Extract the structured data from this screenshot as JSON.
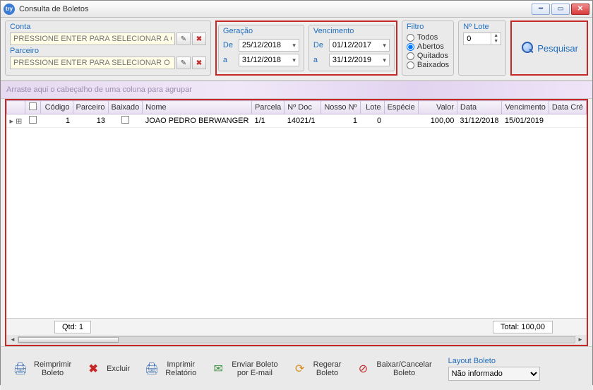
{
  "window": {
    "title": "Consulta de Boletos"
  },
  "account": {
    "conta_label": "Conta",
    "conta_placeholder": "PRESSIONE ENTER PARA SELECIONAR A CONTA",
    "parceiro_label": "Parceiro",
    "parceiro_placeholder": "PRESSIONE ENTER PARA SELECIONAR O PARCEIRO"
  },
  "geracao": {
    "title": "Geração",
    "de_label": "De",
    "de_value": "25/12/2018",
    "a_label": "a",
    "a_value": "31/12/2018"
  },
  "vencimento": {
    "title": "Vencimento",
    "de_label": "De",
    "de_value": "01/12/2017",
    "a_label": "a",
    "a_value": "31/12/2019"
  },
  "filtro": {
    "title": "Filtro",
    "options": [
      "Todos",
      "Abertos",
      "Quitados",
      "Baixados"
    ],
    "selected": "Abertos"
  },
  "lote": {
    "title": "Nº Lote",
    "value": "0"
  },
  "search_label": "Pesquisar",
  "group_hint": "Arraste aqui o cabeçalho de uma coluna para agrupar",
  "columns": [
    "",
    "",
    "Código",
    "Parceiro",
    "Baixado",
    "Nome",
    "Parcela",
    "Nº Doc",
    "Nosso Nº",
    "Lote",
    "Espécie",
    "Valor",
    "Data",
    "Vencimento",
    "Data Cré"
  ],
  "rows": [
    {
      "codigo": "1",
      "parceiro": "13",
      "nome": "JOAO PEDRO BERWANGER",
      "parcela": "1/1",
      "ndoc": "14021/1",
      "nosso": "1",
      "lote": "0",
      "especie": "",
      "valor": "100,00",
      "data": "31/12/2018",
      "venc": "15/01/2019"
    }
  ],
  "footer": {
    "qtd": "Qtd: 1",
    "total": "Total: 100,00"
  },
  "toolbar": {
    "reimprimir": "Reimprimir\nBoleto",
    "excluir": "Excluir",
    "imprimir_rel": "Imprimir\nRelatório",
    "enviar_email": "Enviar Boleto\npor E-mail",
    "regerar": "Regerar\nBoleto",
    "baixar": "Baixar/Cancelar\nBoleto"
  },
  "layout": {
    "label": "Layout Boleto",
    "value": "Não informado"
  }
}
